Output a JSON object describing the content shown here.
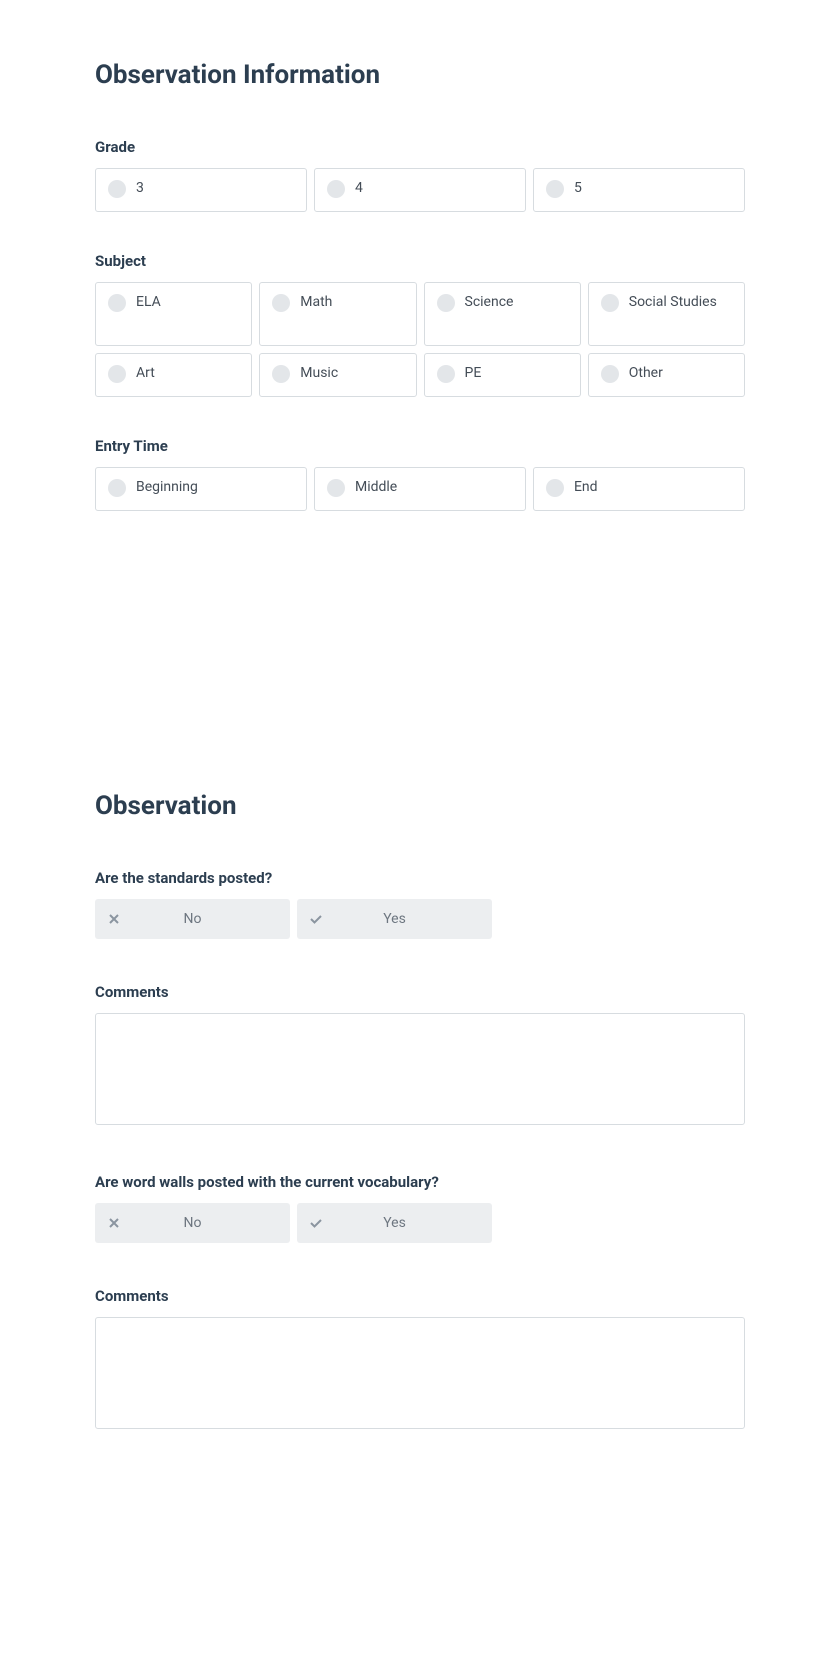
{
  "section1": {
    "title": "Observation Information",
    "grade": {
      "label": "Grade",
      "options": [
        "3",
        "4",
        "5"
      ]
    },
    "subject": {
      "label": "Subject",
      "options": [
        "ELA",
        "Math",
        "Science",
        "Social Studies",
        "Art",
        "Music",
        "PE",
        "Other"
      ]
    },
    "entryTime": {
      "label": "Entry Time",
      "options": [
        "Beginning",
        "Middle",
        "End"
      ]
    }
  },
  "section2": {
    "title": "Observation",
    "q1": {
      "question": "Are the standards posted?",
      "no": "No",
      "yes": "Yes",
      "commentsLabel": "Comments"
    },
    "q2": {
      "question": "Are word walls posted with the current vocabulary?",
      "no": "No",
      "yes": "Yes",
      "commentsLabel": "Comments"
    }
  }
}
